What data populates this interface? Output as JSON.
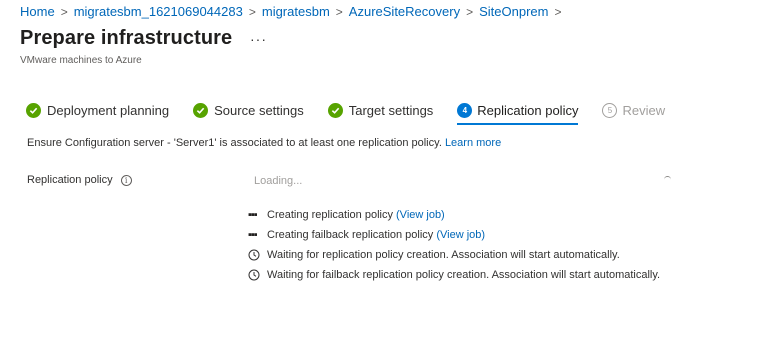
{
  "breadcrumb": {
    "items": [
      "Home",
      "migratesbm_1621069044283",
      "migratesbm",
      "AzureSiteRecovery",
      "SiteOnprem"
    ],
    "separator": ">"
  },
  "header": {
    "title": "Prepare infrastructure",
    "more_label": "···",
    "subtitle": "VMware machines to Azure"
  },
  "steps": [
    {
      "label": "Deployment planning",
      "state": "completed"
    },
    {
      "label": "Source settings",
      "state": "completed"
    },
    {
      "label": "Target settings",
      "state": "completed"
    },
    {
      "label": "Replication policy",
      "state": "active",
      "number": "4"
    },
    {
      "label": "Review",
      "state": "disabled",
      "number": "5"
    }
  ],
  "main": {
    "info_text": "Ensure Configuration server - 'Server1' is associated to at least one replication policy.",
    "learn_more": "Learn more",
    "replication_policy_label": "Replication policy",
    "info_icon": "i",
    "loading_text": "Loading...",
    "statuses": [
      {
        "icon": "dots-icon",
        "text": "Creating replication policy",
        "link": "(View job)"
      },
      {
        "icon": "dots-icon",
        "text": "Creating failback replication policy",
        "link": "(View job)"
      },
      {
        "icon": "clock-icon",
        "text": "Waiting for replication policy creation. Association will start automatically.",
        "link": ""
      },
      {
        "icon": "clock-icon",
        "text": "Waiting for failback replication policy creation. Association will start automatically.",
        "link": ""
      }
    ]
  },
  "colors": {
    "link": "#0067b8",
    "accent": "#0078d4",
    "success": "#57a300",
    "disabled": "#a19f9d"
  }
}
